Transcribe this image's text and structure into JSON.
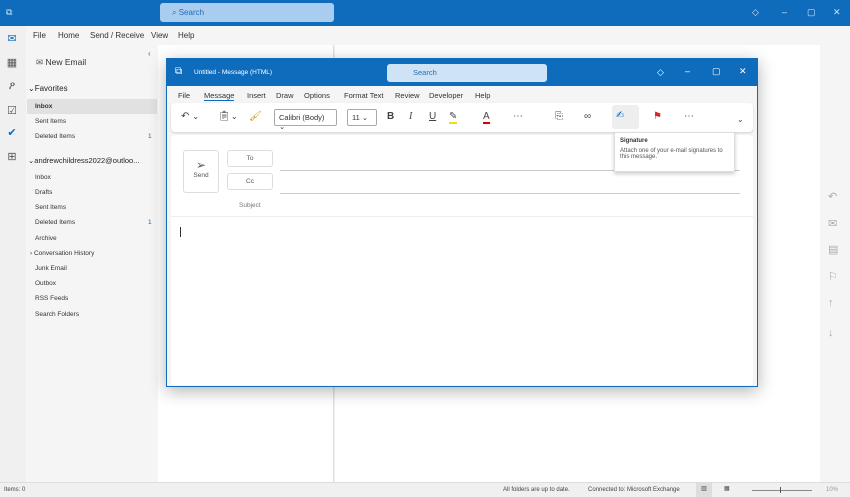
{
  "app": {
    "search_placeholder": "Search"
  },
  "menu": [
    "File",
    "Home",
    "Send / Receive",
    "View",
    "Help"
  ],
  "folders": {
    "new_email": "New Email",
    "favorites_label": "Favorites",
    "favorites": [
      {
        "label": "Inbox"
      },
      {
        "label": "Sent Items"
      },
      {
        "label": "Deleted Items",
        "count": "1"
      }
    ],
    "account": "andrewchildress2022@outloo...",
    "account_folders": [
      {
        "label": "Inbox"
      },
      {
        "label": "Drafts"
      },
      {
        "label": "Sent Items"
      },
      {
        "label": "Deleted Items",
        "count": "1"
      },
      {
        "label": "Archive"
      },
      {
        "label": "Conversation History"
      },
      {
        "label": "Junk Email"
      },
      {
        "label": "Outbox"
      },
      {
        "label": "RSS Feeds"
      },
      {
        "label": "Search Folders"
      }
    ]
  },
  "compose": {
    "title": "Untitled  -  Message (HTML)",
    "search_placeholder": "Search",
    "tabs": [
      "File",
      "Message",
      "Insert",
      "Draw",
      "Options",
      "Format Text",
      "Review",
      "Developer",
      "Help"
    ],
    "font": "Calibri (Body)",
    "font_size": "11",
    "send": "Send",
    "to": "To",
    "cc": "Cc",
    "subject": "Subject",
    "tooltip_title": "Signature",
    "tooltip_text": "Attach one of your e-mail signatures to this message."
  },
  "status": {
    "items": "Items: 0",
    "sync": "All folders are up to date.",
    "connection": "Connected to: Microsoft Exchange",
    "zoom": "10%"
  }
}
